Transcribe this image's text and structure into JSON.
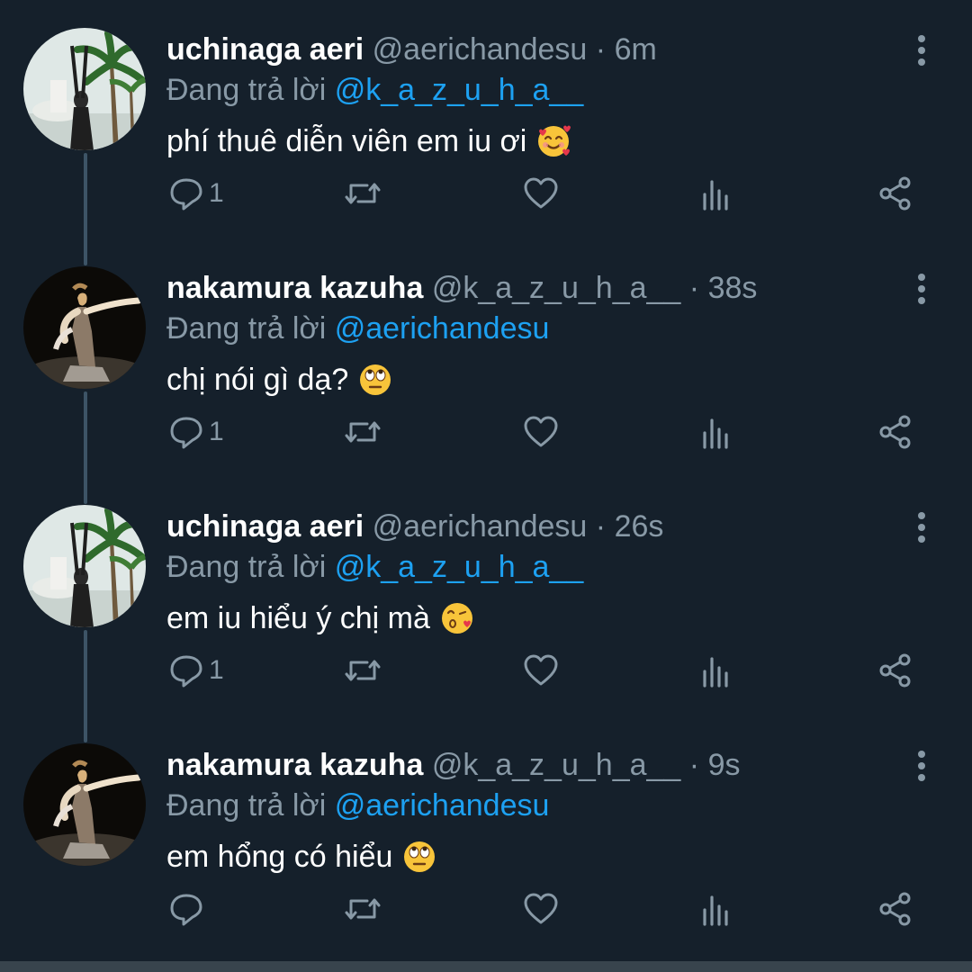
{
  "colors": {
    "background": "#15202b",
    "text_primary": "#ffffff",
    "text_secondary": "#8899a6",
    "link": "#1da1f2",
    "thread_line": "#3d5466"
  },
  "tweets": [
    {
      "name": "uchinaga aeri",
      "handle": "@aerichandesu",
      "time": "6m",
      "reply_prefix": "Đang trả lời",
      "reply_to": "@k_a_z_u_h_a__",
      "text": "phí thuê diễn viên em iu ơi",
      "emoji": "smiling-face-with-hearts",
      "reply_count": "1",
      "avatar_icon": "avatar-palm-trees"
    },
    {
      "name": "nakamura kazuha",
      "handle": "@k_a_z_u_h_a__",
      "time": "38s",
      "reply_prefix": "Đang trả lời",
      "reply_to": "@aerichandesu",
      "text": "chị nói gì dạ?",
      "emoji": "face-with-rolling-eyes",
      "reply_count": "1",
      "avatar_icon": "avatar-dancer"
    },
    {
      "name": "uchinaga aeri",
      "handle": "@aerichandesu",
      "time": "26s",
      "reply_prefix": "Đang trả lời",
      "reply_to": "@k_a_z_u_h_a__",
      "text": "em iu hiểu ý chị mà",
      "emoji": "face-blowing-a-kiss",
      "reply_count": "1",
      "avatar_icon": "avatar-palm-trees"
    },
    {
      "name": "nakamura kazuha",
      "handle": "@k_a_z_u_h_a__",
      "time": "9s",
      "reply_prefix": "Đang trả lời",
      "reply_to": "@aerichandesu",
      "text": "em hổng có hiểu",
      "emoji": "face-with-rolling-eyes",
      "reply_count": "",
      "avatar_icon": "avatar-dancer"
    }
  ],
  "icons": {
    "reply": "reply-icon",
    "retweet": "retweet-icon",
    "like": "heart-icon",
    "stats": "analytics-icon",
    "share": "share-icon",
    "more": "more-vertical-icon"
  }
}
